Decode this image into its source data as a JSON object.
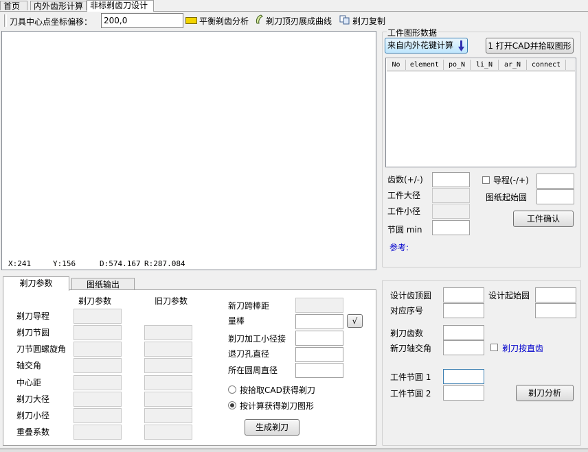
{
  "tabs": [
    {
      "label": "首页"
    },
    {
      "label": "内外齿形计算"
    },
    {
      "label": "非标剃齿刀设计"
    }
  ],
  "toolbar": {
    "offset_label": "刀具中心点坐标偏移：",
    "offset_value": "200,0",
    "balance_label": "平衡剃齿分析",
    "tip_curve_label": "剃刀顶刃展成曲线",
    "copy_label": "剃刀复制"
  },
  "canvas": {
    "x_text": "X:241",
    "y_text": "Y:156",
    "d_text": "D:574.167",
    "r_text": "R:287.084"
  },
  "workpiece": {
    "group_title": "工件图形数据",
    "from_spline_btn": "来自内外花键计算",
    "open_cad_btn": "1 打开CAD并拾取图形",
    "columns": [
      "No",
      "element",
      "po_N",
      "li_N",
      "ar_N",
      "connect"
    ],
    "teeth_label": "齿数(+/-)",
    "major_label": "工件大径",
    "minor_label": "工件小径",
    "pitch_min_label": "节圆 min",
    "lead_label": "导程(-/+)",
    "drawing_start_label": "图纸起始圆",
    "confirm_btn": "工件确认",
    "ref_label": "参考:"
  },
  "bottom_tabs": [
    {
      "label": "剃刀参数"
    },
    {
      "label": "图纸输出"
    }
  ],
  "cutter": {
    "col_new": "剃刀参数",
    "col_old": "旧刀参数",
    "rows": [
      "剃刀导程",
      "剃刀节圆",
      "刀节圆螺旋角",
      "轴交角",
      "中心距",
      "剃刀大径",
      "剃刀小径",
      "重叠系数"
    ],
    "span_label": "新刀跨棒距",
    "rod_label": "量棒",
    "check_btn": "√",
    "machining_label": "剃刀加工小径接",
    "relief_label": "退刀孔直径",
    "circle_label": "所在圆周直径",
    "radio_cad": "按拾取CAD获得剃刀",
    "radio_calc": "按计算获得剃刀图形",
    "generate_btn": "生成剃刀"
  },
  "design": {
    "tip_label": "设计齿顶圆",
    "start_label": "设计起始圆",
    "seq_label": "对应序号",
    "teeth_label": "剃刀齿数",
    "axis_label": "新刀轴交角",
    "straight_label": "剃刀按直齿",
    "pitch1_label": "工件节圆 1",
    "pitch2_label": "工件节圆 2",
    "analyze_btn": "剃刀分析"
  },
  "colors": {
    "accent_link": "#0000cc",
    "balance_icon": "#f2d400"
  }
}
